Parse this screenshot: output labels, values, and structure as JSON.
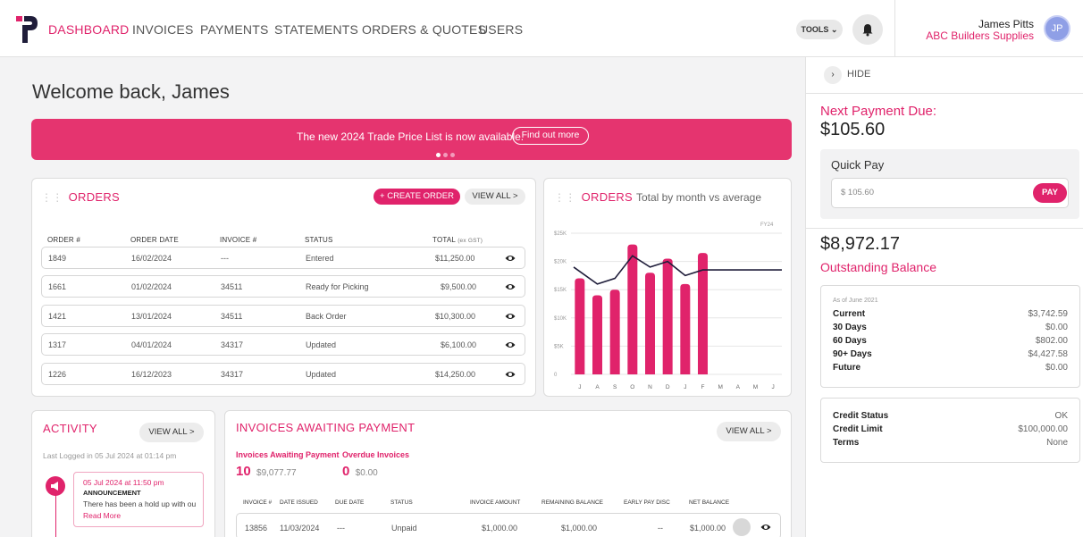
{
  "nav": {
    "items": [
      "DASHBOARD",
      "INVOICES",
      "PAYMENTS",
      "STATEMENTS",
      "ORDERS & QUOTES",
      "USERS"
    ],
    "tools_label": "TOOLS",
    "user_name": "James Pitts",
    "company": "ABC Builders Supplies",
    "avatar_initials": "JP"
  },
  "welcome": "Welcome back, James",
  "banner": {
    "text": "The new 2024 Trade Price List is now available.",
    "button": "Find out more"
  },
  "orders": {
    "title": "ORDERS",
    "create_label": "+ CREATE ORDER",
    "view_all_label": "VIEW ALL >",
    "headers": [
      "ORDER #",
      "ORDER DATE",
      "INVOICE #",
      "STATUS",
      "TOTAL"
    ],
    "total_suffix": "(ex GST)",
    "rows": [
      [
        "1849",
        "16/02/2024",
        "---",
        "Entered",
        "$11,250.00"
      ],
      [
        "1661",
        "01/02/2024",
        "34511",
        "Ready for Picking",
        "$9,500.00"
      ],
      [
        "1421",
        "13/01/2024",
        "34511",
        "Back Order",
        "$10,300.00"
      ],
      [
        "1317",
        "04/01/2024",
        "34317",
        "Updated",
        "$6,100.00"
      ],
      [
        "1226",
        "16/12/2023",
        "34317",
        "Updated",
        "$14,250.00"
      ]
    ]
  },
  "orders_chart": {
    "title": "ORDERS",
    "subtitle": "Total by month vs average"
  },
  "chart_data": {
    "type": "bar",
    "title": "ORDERS Total by month vs average",
    "legend": "FY24",
    "categories": [
      "J",
      "A",
      "S",
      "O",
      "N",
      "D",
      "J",
      "F",
      "M",
      "A",
      "M",
      "J"
    ],
    "y_ticks": [
      "0",
      "$5K",
      "$10K",
      "$15K",
      "$20K",
      "$25K"
    ],
    "ylim": [
      0,
      25000
    ],
    "series": [
      {
        "name": "Total",
        "values": [
          17000,
          14000,
          15000,
          23000,
          18000,
          20500,
          16000,
          21500,
          0,
          0,
          0,
          0
        ]
      }
    ],
    "average_line": [
      19000,
      16000,
      17000,
      21000,
      19000,
      20000,
      17500,
      18500,
      18500,
      18500,
      18500,
      18500
    ],
    "bar_color": "#e0236b",
    "line_color": "#1f1d3a"
  },
  "activity": {
    "title": "ACTIVITY",
    "view_all_label": "VIEW ALL >",
    "last_logged": "Last Logged in 05 Jul 2024 at 01:14 pm",
    "item": {
      "time": "05 Jul 2024 at 11:50 pm",
      "type": "ANNOUNCEMENT",
      "text": "There has been a hold up with ou",
      "link": "Read More"
    }
  },
  "invoices": {
    "title": "INVOICES AWAITING PAYMENT",
    "view_all_label": "VIEW ALL >",
    "awaiting_label": "Invoices Awaiting Payment",
    "awaiting_count": "10",
    "awaiting_amount": "$9,077.77",
    "overdue_label": "Overdue Invoices",
    "overdue_count": "0",
    "overdue_amount": "$0.00",
    "headers": [
      "INVOICE #",
      "DATE ISSUED",
      "DUE DATE",
      "STATUS",
      "INVOICE AMOUNT",
      "REMAINING BALANCE",
      "EARLY PAY DISC",
      "NET BALANCE"
    ],
    "row": [
      "13856",
      "11/03/2024",
      "---",
      "Unpaid",
      "$1,000.00",
      "$1,000.00",
      "--",
      "$1,000.00"
    ]
  },
  "right_panel": {
    "hide_label": "HIDE",
    "next_payment_label": "Next Payment Due:",
    "next_payment_amount": "$105.60",
    "quick_pay_label": "Quick Pay",
    "quick_pay_value": "$ 105.60",
    "pay_label": "PAY",
    "outstanding_amount": "$8,972.17",
    "outstanding_label": "Outstanding Balance",
    "aging_note": "As of June 2021",
    "aging": [
      [
        "Current",
        "$3,742.59"
      ],
      [
        "30 Days",
        "$0.00"
      ],
      [
        "60 Days",
        "$802.00"
      ],
      [
        "90+ Days",
        "$4,427.58"
      ],
      [
        "Future",
        "$0.00"
      ]
    ],
    "credit": [
      [
        "Credit Status",
        "OK"
      ],
      [
        "Credit Limit",
        "$100,000.00"
      ],
      [
        "Terms",
        "None"
      ]
    ]
  }
}
